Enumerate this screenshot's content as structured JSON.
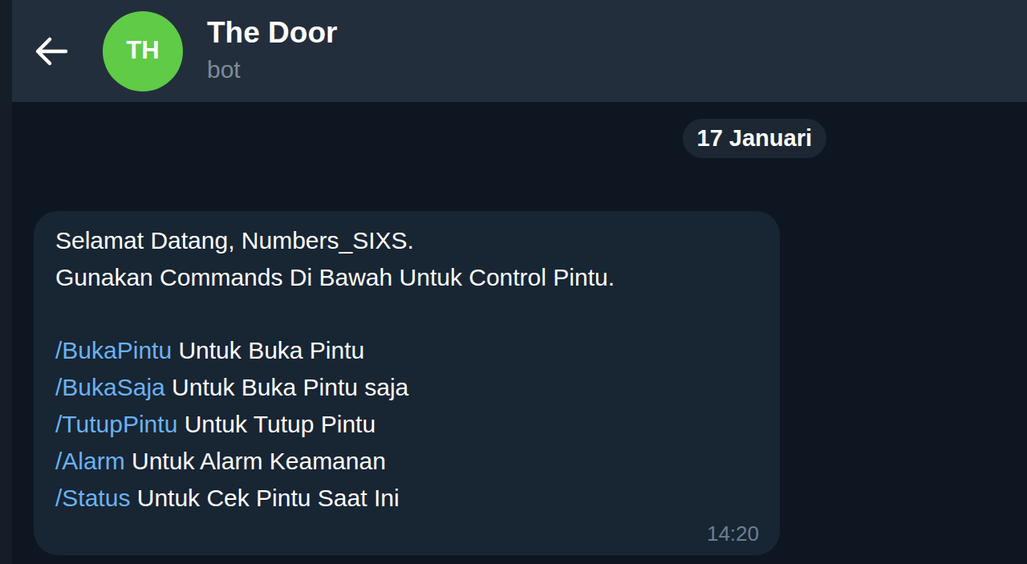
{
  "header": {
    "title": "The Door",
    "subtitle": "bot",
    "avatar_initials": "TH"
  },
  "date_badge": "17 Januari",
  "message": {
    "lines": [
      "Selamat Datang, Numbers_SIXS.",
      "Gunakan Commands Di Bawah Untuk Control Pintu."
    ],
    "commands": [
      {
        "command": "/BukaPintu",
        "description": " Untuk Buka Pintu"
      },
      {
        "command": "/BukaSaja",
        "description": " Untuk Buka Pintu saja"
      },
      {
        "command": "/TutupPintu",
        "description": " Untuk Tutup Pintu"
      },
      {
        "command": "/Alarm",
        "description": " Untuk Alarm Keamanan"
      },
      {
        "command": "/Status",
        "description": " Untuk Cek Pintu Saat Ini"
      }
    ],
    "time": "14:20"
  }
}
